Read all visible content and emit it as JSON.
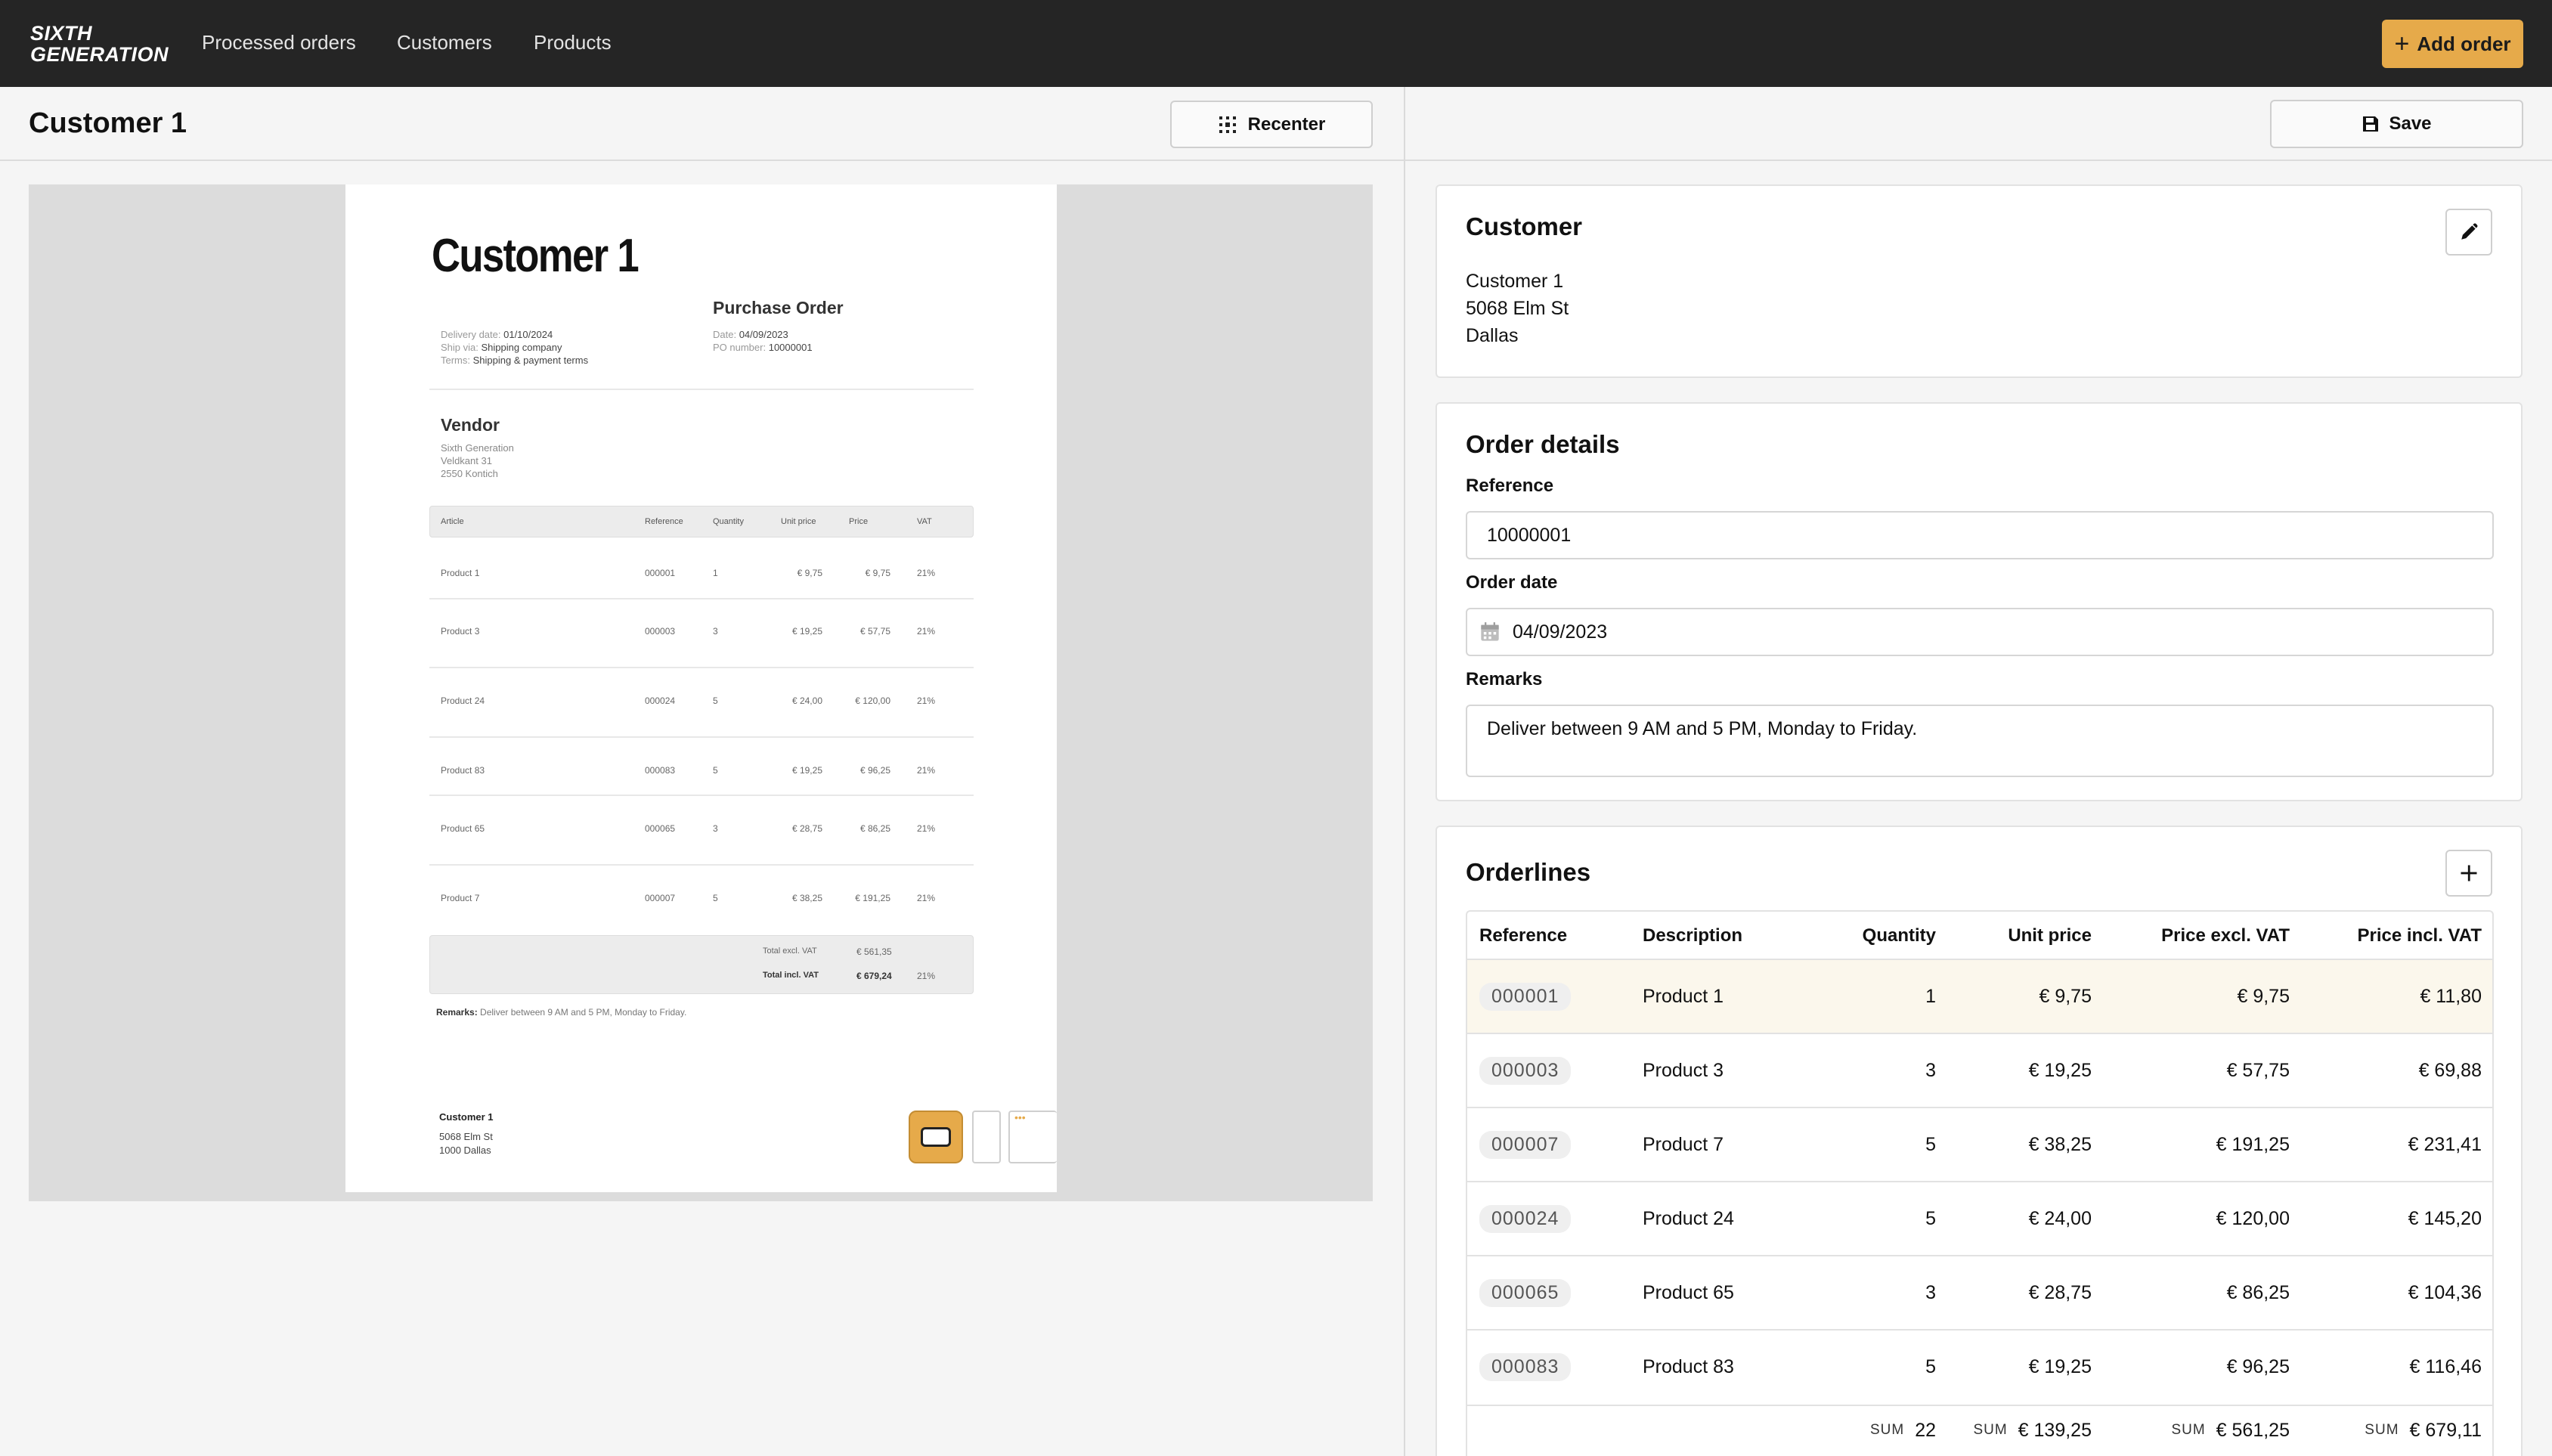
{
  "brand": {
    "line1": "SIXTH",
    "line2": "GENERATION"
  },
  "nav": {
    "links": [
      "Processed orders",
      "Customers",
      "Products"
    ],
    "add_order_label": "Add order"
  },
  "left": {
    "title": "Customer 1",
    "recenter_label": "Recenter"
  },
  "document": {
    "title": "Customer 1",
    "po_title": "Purchase Order",
    "meta_left": [
      {
        "k": "Delivery date:",
        "v": "01/10/2024"
      },
      {
        "k": "Ship via:",
        "v": "Shipping company"
      },
      {
        "k": "Terms:",
        "v": "Shipping & payment terms"
      }
    ],
    "meta_right": [
      {
        "k": "Date:",
        "v": "04/09/2023"
      },
      {
        "k": "PO number:",
        "v": "10000001"
      }
    ],
    "vendor_title": "Vendor",
    "vendor_lines": [
      "Sixth Generation",
      "Veldkant 31",
      "2550 Kontich"
    ],
    "table_headers": [
      "Article",
      "Reference",
      "Quantity",
      "Unit price",
      "Price",
      "VAT"
    ],
    "rows": [
      [
        "Product 1",
        "000001",
        "1",
        "€ 9,75",
        "€ 9,75",
        "21%"
      ],
      [
        "Product 3",
        "000003",
        "3",
        "€ 19,25",
        "€ 57,75",
        "21%"
      ],
      [
        "Product 24",
        "000024",
        "5",
        "€ 24,00",
        "€ 120,00",
        "21%"
      ],
      [
        "Product 83",
        "000083",
        "5",
        "€ 19,25",
        "€ 96,25",
        "21%"
      ],
      [
        "Product 65",
        "000065",
        "3",
        "€ 28,75",
        "€ 86,25",
        "21%"
      ],
      [
        "Product 7",
        "000007",
        "5",
        "€ 38,25",
        "€ 191,25",
        "21%"
      ]
    ],
    "totals": [
      {
        "label": "Total excl. VAT",
        "value": "€ 561,35",
        "vat": ""
      },
      {
        "label": "Total incl. VAT",
        "value": "€ 679,24",
        "vat": "21%"
      }
    ],
    "remarks_label": "Remarks:",
    "remarks_text": "Deliver between 9 AM and 5 PM, Monday to Friday.",
    "footer_name": "Customer 1",
    "footer_lines": [
      "5068 Elm St",
      "1000 Dallas"
    ]
  },
  "right": {
    "save_label": "Save",
    "customer": {
      "title": "Customer",
      "lines": [
        "Customer 1",
        "5068 Elm St",
        "Dallas"
      ]
    },
    "order": {
      "title": "Order details",
      "reference_label": "Reference",
      "reference_value": "10000001",
      "date_label": "Order date",
      "date_value": "04/09/2023",
      "remarks_label": "Remarks",
      "remarks_value": "Deliver between 9 AM and 5 PM, Monday to Friday."
    },
    "orderlines": {
      "title": "Orderlines",
      "headers": [
        "Reference",
        "Description",
        "Quantity",
        "Unit price",
        "Price excl. VAT",
        "Price incl. VAT"
      ],
      "rows": [
        [
          "000001",
          "Product 1",
          "1",
          "€ 9,75",
          "€ 9,75",
          "€ 11,80"
        ],
        [
          "000003",
          "Product 3",
          "3",
          "€ 19,25",
          "€ 57,75",
          "€ 69,88"
        ],
        [
          "000007",
          "Product 7",
          "5",
          "€ 38,25",
          "€ 191,25",
          "€ 231,41"
        ],
        [
          "000024",
          "Product 24",
          "5",
          "€ 24,00",
          "€ 120,00",
          "€ 145,20"
        ],
        [
          "000065",
          "Product 65",
          "3",
          "€ 28,75",
          "€ 86,25",
          "€ 104,36"
        ],
        [
          "000083",
          "Product 83",
          "5",
          "€ 19,25",
          "€ 96,25",
          "€ 116,46"
        ]
      ],
      "sum_tag": "SUM",
      "sums": [
        "22",
        "€ 139,25",
        "€ 561,25",
        "€ 679,11"
      ]
    }
  },
  "colors": {
    "accent": "#e6aa4a",
    "topbar": "#252525",
    "highlight_row": "#fbf7ec"
  }
}
